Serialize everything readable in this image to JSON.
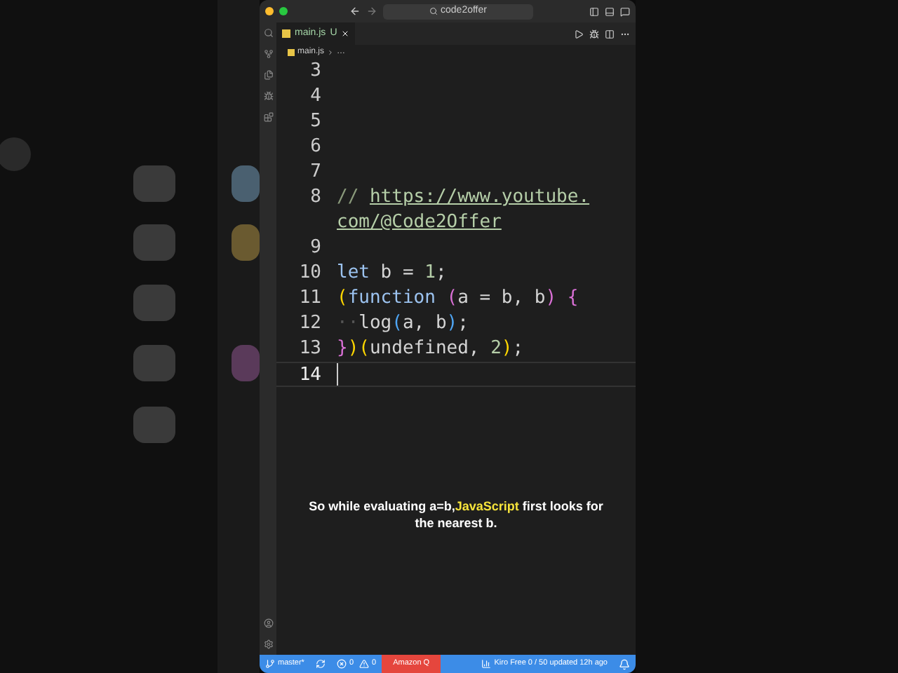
{
  "window": {
    "title": "code2offer"
  },
  "tabs": [
    {
      "label": "main.js",
      "status": "U",
      "selected": true
    }
  ],
  "breadcrumb": [
    "main.js",
    "…"
  ],
  "code": [
    {
      "number": "3"
    },
    {
      "number": "4"
    },
    {
      "number": "5"
    },
    {
      "number": "6"
    },
    {
      "number": "7"
    },
    {
      "number": "8",
      "tokens": [
        {
          "kind": "comment",
          "text": "// "
        },
        {
          "kind": "link",
          "text": "https://www.youtube."
        }
      ]
    },
    {
      "tokens": [
        {
          "kind": "link",
          "text": "com/@Code2Offer"
        }
      ]
    },
    {
      "number": "9"
    },
    {
      "number": "10",
      "tokens": [
        {
          "kind": "keyword",
          "text": "let"
        },
        {
          "kind": "plain",
          "text": " b = "
        },
        {
          "kind": "number",
          "text": "1"
        },
        {
          "kind": "plain",
          "text": ";"
        }
      ]
    },
    {
      "number": "11",
      "tokens": [
        {
          "kind": "bracket1",
          "text": "("
        },
        {
          "kind": "keyword",
          "text": "function"
        },
        {
          "kind": "bracket2",
          "text": " ("
        },
        {
          "kind": "plain",
          "text": "a = b, b"
        },
        {
          "kind": "bracket2",
          "text": ")"
        },
        {
          "kind": "bracket2",
          "text": " {"
        }
      ]
    },
    {
      "number": "12",
      "tokens": [
        {
          "kind": "whitespace",
          "text": "··"
        },
        {
          "kind": "plain",
          "text": "log"
        },
        {
          "kind": "bracket3",
          "text": "("
        },
        {
          "kind": "plain",
          "text": "a, b"
        },
        {
          "kind": "bracket3",
          "text": ")"
        },
        {
          "kind": "plain",
          "text": ";"
        }
      ]
    },
    {
      "number": "13",
      "tokens": [
        {
          "kind": "bracket2",
          "text": "}"
        },
        {
          "kind": "bracket1",
          "text": ")"
        },
        {
          "kind": "bracket1",
          "text": "("
        },
        {
          "kind": "plain",
          "text": "undefined, "
        },
        {
          "kind": "number",
          "text": "2"
        },
        {
          "kind": "bracket1",
          "text": ")"
        },
        {
          "kind": "plain",
          "text": ";"
        }
      ]
    },
    {
      "number": "14",
      "current": true
    }
  ],
  "caption": [
    {
      "text": "So while evaluating a=b,",
      "highlight": false
    },
    {
      "text": "JavaScript",
      "highlight": true
    },
    {
      "text": " first looks for the nearest b.",
      "highlight": false
    }
  ],
  "status_bar": [
    {
      "kind": "branch",
      "text": "master*"
    },
    {
      "kind": "sync"
    },
    {
      "kind": "errors",
      "text": "0"
    },
    {
      "kind": "warnings",
      "text": "0"
    },
    {
      "kind": "alert",
      "text": "Amazon Q"
    },
    {
      "kind": "spacer"
    },
    {
      "kind": "chart",
      "text": "Kiro Free 0 / 50 updated 12h ago"
    },
    {
      "kind": "bell"
    }
  ]
}
